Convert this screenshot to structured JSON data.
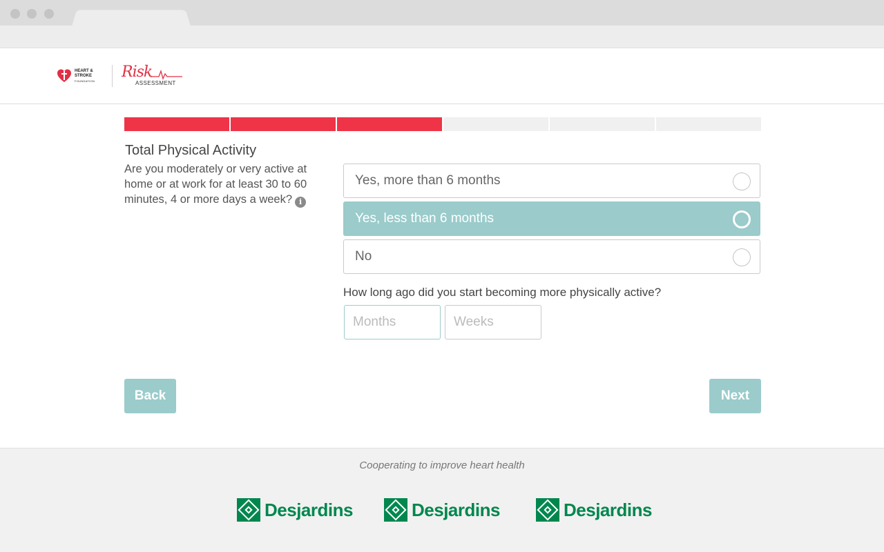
{
  "header": {
    "hs_logo_text": "HEART & STROKE",
    "hs_logo_sub": "FOUNDATION",
    "risk_logo_word": "Risk",
    "risk_logo_sub": "ASSESSMENT"
  },
  "progress": {
    "total_steps": 6,
    "completed_steps": 3
  },
  "question": {
    "title": "Total Physical Activity",
    "text": "Are you moderately or very active at home or at work for at least 30 to 60 minutes, 4 or more days a week?",
    "info_icon": "info-icon",
    "options": [
      {
        "label": "Yes, more than 6 months",
        "selected": false
      },
      {
        "label": "Yes, less than 6 months",
        "selected": true
      },
      {
        "label": "No",
        "selected": false
      }
    ]
  },
  "followup": {
    "question": "How long ago did you start becoming more physically active?",
    "months_placeholder": "Months",
    "weeks_placeholder": "Weeks"
  },
  "nav": {
    "back_label": "Back",
    "next_label": "Next"
  },
  "footer": {
    "tagline": "Cooperating to improve heart health",
    "partners": [
      "Desjardins",
      "Desjardins",
      "Desjardins"
    ]
  },
  "colors": {
    "accent_red": "#ef3448",
    "teal": "#9bcbcb",
    "partner_green": "#00874e"
  }
}
